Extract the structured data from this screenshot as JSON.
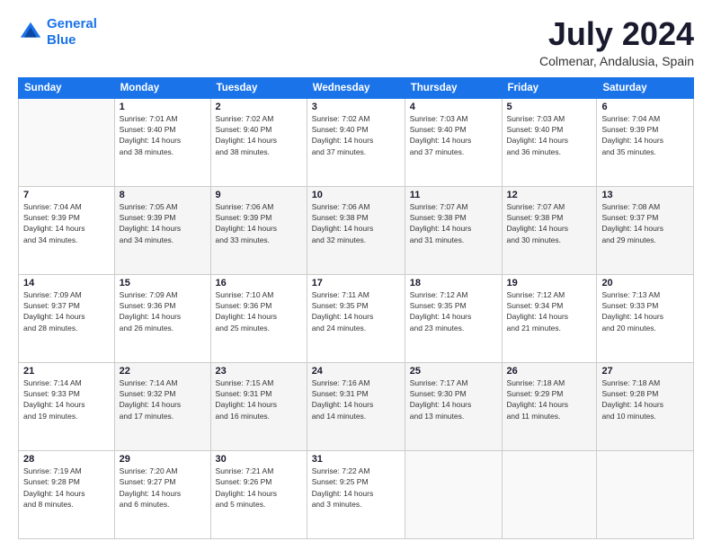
{
  "header": {
    "logo_line1": "General",
    "logo_line2": "Blue",
    "month": "July 2024",
    "location": "Colmenar, Andalusia, Spain"
  },
  "weekdays": [
    "Sunday",
    "Monday",
    "Tuesday",
    "Wednesday",
    "Thursday",
    "Friday",
    "Saturday"
  ],
  "weeks": [
    [
      {
        "day": "",
        "info": ""
      },
      {
        "day": "1",
        "info": "Sunrise: 7:01 AM\nSunset: 9:40 PM\nDaylight: 14 hours\nand 38 minutes."
      },
      {
        "day": "2",
        "info": "Sunrise: 7:02 AM\nSunset: 9:40 PM\nDaylight: 14 hours\nand 38 minutes."
      },
      {
        "day": "3",
        "info": "Sunrise: 7:02 AM\nSunset: 9:40 PM\nDaylight: 14 hours\nand 37 minutes."
      },
      {
        "day": "4",
        "info": "Sunrise: 7:03 AM\nSunset: 9:40 PM\nDaylight: 14 hours\nand 37 minutes."
      },
      {
        "day": "5",
        "info": "Sunrise: 7:03 AM\nSunset: 9:40 PM\nDaylight: 14 hours\nand 36 minutes."
      },
      {
        "day": "6",
        "info": "Sunrise: 7:04 AM\nSunset: 9:39 PM\nDaylight: 14 hours\nand 35 minutes."
      }
    ],
    [
      {
        "day": "7",
        "info": "Sunrise: 7:04 AM\nSunset: 9:39 PM\nDaylight: 14 hours\nand 34 minutes."
      },
      {
        "day": "8",
        "info": "Sunrise: 7:05 AM\nSunset: 9:39 PM\nDaylight: 14 hours\nand 34 minutes."
      },
      {
        "day": "9",
        "info": "Sunrise: 7:06 AM\nSunset: 9:39 PM\nDaylight: 14 hours\nand 33 minutes."
      },
      {
        "day": "10",
        "info": "Sunrise: 7:06 AM\nSunset: 9:38 PM\nDaylight: 14 hours\nand 32 minutes."
      },
      {
        "day": "11",
        "info": "Sunrise: 7:07 AM\nSunset: 9:38 PM\nDaylight: 14 hours\nand 31 minutes."
      },
      {
        "day": "12",
        "info": "Sunrise: 7:07 AM\nSunset: 9:38 PM\nDaylight: 14 hours\nand 30 minutes."
      },
      {
        "day": "13",
        "info": "Sunrise: 7:08 AM\nSunset: 9:37 PM\nDaylight: 14 hours\nand 29 minutes."
      }
    ],
    [
      {
        "day": "14",
        "info": "Sunrise: 7:09 AM\nSunset: 9:37 PM\nDaylight: 14 hours\nand 28 minutes."
      },
      {
        "day": "15",
        "info": "Sunrise: 7:09 AM\nSunset: 9:36 PM\nDaylight: 14 hours\nand 26 minutes."
      },
      {
        "day": "16",
        "info": "Sunrise: 7:10 AM\nSunset: 9:36 PM\nDaylight: 14 hours\nand 25 minutes."
      },
      {
        "day": "17",
        "info": "Sunrise: 7:11 AM\nSunset: 9:35 PM\nDaylight: 14 hours\nand 24 minutes."
      },
      {
        "day": "18",
        "info": "Sunrise: 7:12 AM\nSunset: 9:35 PM\nDaylight: 14 hours\nand 23 minutes."
      },
      {
        "day": "19",
        "info": "Sunrise: 7:12 AM\nSunset: 9:34 PM\nDaylight: 14 hours\nand 21 minutes."
      },
      {
        "day": "20",
        "info": "Sunrise: 7:13 AM\nSunset: 9:33 PM\nDaylight: 14 hours\nand 20 minutes."
      }
    ],
    [
      {
        "day": "21",
        "info": "Sunrise: 7:14 AM\nSunset: 9:33 PM\nDaylight: 14 hours\nand 19 minutes."
      },
      {
        "day": "22",
        "info": "Sunrise: 7:14 AM\nSunset: 9:32 PM\nDaylight: 14 hours\nand 17 minutes."
      },
      {
        "day": "23",
        "info": "Sunrise: 7:15 AM\nSunset: 9:31 PM\nDaylight: 14 hours\nand 16 minutes."
      },
      {
        "day": "24",
        "info": "Sunrise: 7:16 AM\nSunset: 9:31 PM\nDaylight: 14 hours\nand 14 minutes."
      },
      {
        "day": "25",
        "info": "Sunrise: 7:17 AM\nSunset: 9:30 PM\nDaylight: 14 hours\nand 13 minutes."
      },
      {
        "day": "26",
        "info": "Sunrise: 7:18 AM\nSunset: 9:29 PM\nDaylight: 14 hours\nand 11 minutes."
      },
      {
        "day": "27",
        "info": "Sunrise: 7:18 AM\nSunset: 9:28 PM\nDaylight: 14 hours\nand 10 minutes."
      }
    ],
    [
      {
        "day": "28",
        "info": "Sunrise: 7:19 AM\nSunset: 9:28 PM\nDaylight: 14 hours\nand 8 minutes."
      },
      {
        "day": "29",
        "info": "Sunrise: 7:20 AM\nSunset: 9:27 PM\nDaylight: 14 hours\nand 6 minutes."
      },
      {
        "day": "30",
        "info": "Sunrise: 7:21 AM\nSunset: 9:26 PM\nDaylight: 14 hours\nand 5 minutes."
      },
      {
        "day": "31",
        "info": "Sunrise: 7:22 AM\nSunset: 9:25 PM\nDaylight: 14 hours\nand 3 minutes."
      },
      {
        "day": "",
        "info": ""
      },
      {
        "day": "",
        "info": ""
      },
      {
        "day": "",
        "info": ""
      }
    ]
  ]
}
